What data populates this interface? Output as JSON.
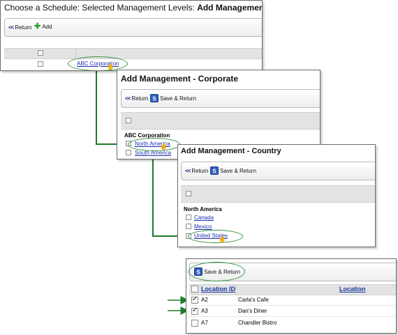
{
  "panel1": {
    "title_prefix": "Choose a Schedule: Selected Management Levels: ",
    "title_bold": "Add Management",
    "toolbar": {
      "return_label": "Return",
      "add_label": "Add"
    },
    "link": "ABC Corporation"
  },
  "panel2": {
    "title": "Add Management - Corporate",
    "toolbar": {
      "return_label": "Return",
      "save_return_label": "Save & Return"
    },
    "group": "ABC Corporation",
    "links": [
      "North America",
      "South America"
    ]
  },
  "panel3": {
    "title": "Add Management - Country",
    "toolbar": {
      "return_label": "Return",
      "save_return_label": "Save & Return"
    },
    "group": "North America",
    "links": [
      "Canada",
      "Mexico",
      "United States"
    ]
  },
  "panel4": {
    "toolbar": {
      "save_return_label": "Save & Return"
    },
    "columns": [
      "Location ID",
      "Location"
    ],
    "rows": [
      {
        "id": "A2",
        "name": "Carla's Cafe",
        "checked": true
      },
      {
        "id": "A3",
        "name": "Dan's Diner",
        "checked": true
      },
      {
        "id": "A7",
        "name": "Chandler Bistro",
        "checked": false
      }
    ]
  },
  "colors": {
    "accent_green": "#2f8f3a",
    "connector": "#1f7a2a",
    "link_blue": "#1a2fb0"
  },
  "icons": [
    "double-chevron-left-icon",
    "plus-icon",
    "save-icon",
    "hand-cursor-icon",
    "arrow-right-icon"
  ]
}
